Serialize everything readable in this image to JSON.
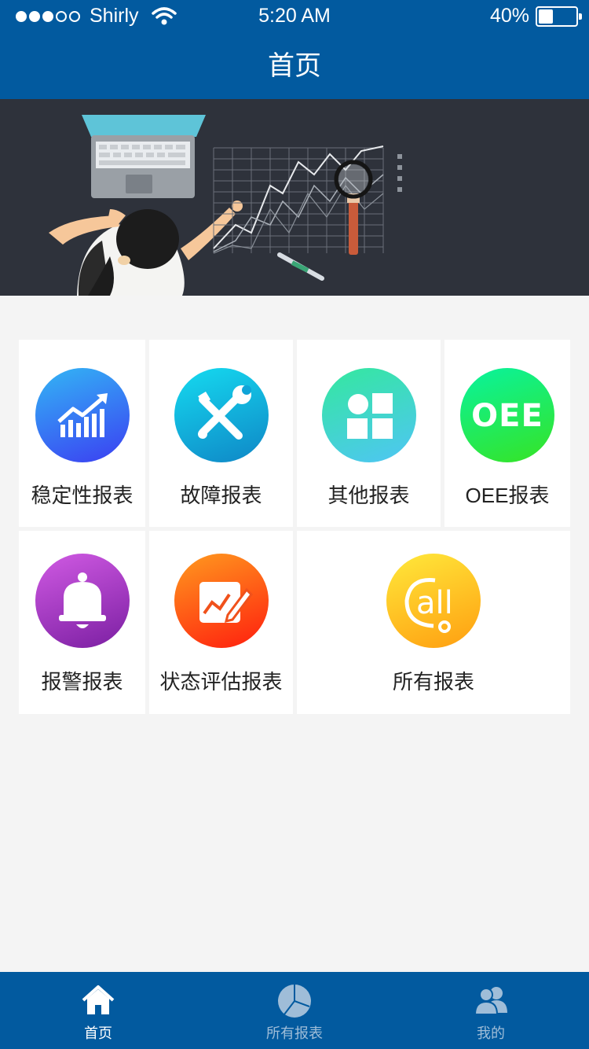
{
  "status_bar": {
    "carrier": "Shirly",
    "time": "5:20 AM",
    "battery": "40%",
    "signal_bars": 3,
    "battery_level": 0.4
  },
  "header": {
    "title": "首页"
  },
  "banner": {
    "icon": "data-analysis-illustration"
  },
  "reports": [
    {
      "label": "稳定性报表",
      "icon": "trend-chart-icon",
      "gradient": [
        "#33b6f5",
        "#3b3ef2"
      ]
    },
    {
      "label": "故障报表",
      "icon": "tools-icon",
      "gradient": [
        "#15dbf0",
        "#0f86c6"
      ]
    },
    {
      "label": "其他报表",
      "icon": "apps-grid-icon",
      "gradient": [
        "#34e89e",
        "#4fc5f5"
      ]
    },
    {
      "label": "OEE报表",
      "icon": "oee-icon",
      "icon_text": "OEE",
      "gradient": [
        "#08f39f",
        "#37e323"
      ]
    },
    {
      "label": "报警报表",
      "icon": "bell-icon",
      "gradient": [
        "#d05ae3",
        "#7b1fa2"
      ]
    },
    {
      "label": "状态评估报表",
      "icon": "assessment-icon",
      "gradient": [
        "#ff9a1f",
        "#ff1e0e"
      ]
    },
    {
      "label": "所有报表",
      "icon": "call-all-icon",
      "icon_text": "all",
      "gradient": [
        "#ffe93b",
        "#ff9e10"
      ]
    }
  ],
  "tab_bar": {
    "active_color": "#ffffff",
    "inactive_color": "#9fbdd8",
    "tabs": [
      {
        "label": "首页",
        "icon": "home-icon",
        "active": true
      },
      {
        "label": "所有报表",
        "icon": "pie-chart-icon",
        "active": false
      },
      {
        "label": "我的",
        "icon": "users-icon",
        "active": false
      }
    ]
  }
}
